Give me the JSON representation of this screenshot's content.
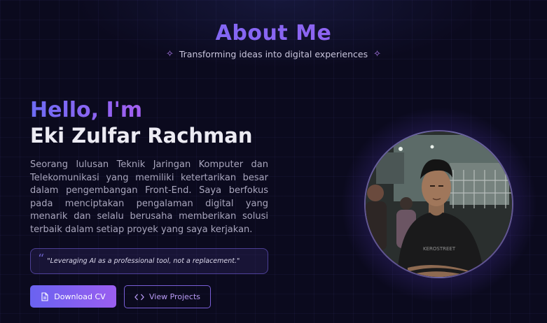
{
  "section": {
    "title": "About Me",
    "subtitle": "Transforming ideas into digital experiences"
  },
  "intro": {
    "greeting": "Hello, I'm",
    "name": "Eki Zulfar Rachman",
    "bio": "Seorang lulusan Teknik Jaringan Komputer dan Telekomunikasi yang memiliki ketertarikan besar dalam pengembangan Front-End. Saya berfokus pada menciptakan pengalaman digital yang menarik dan selalu berusaha memberikan solusi terbaik dalam setiap proyek yang saya kerjakan.",
    "quote": "\"Leveraging AI as a professional tool, not a replacement.\""
  },
  "buttons": {
    "download_cv": "Download CV",
    "view_projects": "View Projects"
  },
  "profile_photo": {
    "shirt_text": "KEROSTREET"
  },
  "icons": {
    "sparkle": "sparkle-icon",
    "quote": "quote-icon",
    "document": "document-icon",
    "code": "code-icon"
  },
  "colors": {
    "background": "#0b0a1e",
    "accent_start": "#6e6cf5",
    "accent_end": "#a35ff0",
    "body_text": "#a9a6bd"
  }
}
